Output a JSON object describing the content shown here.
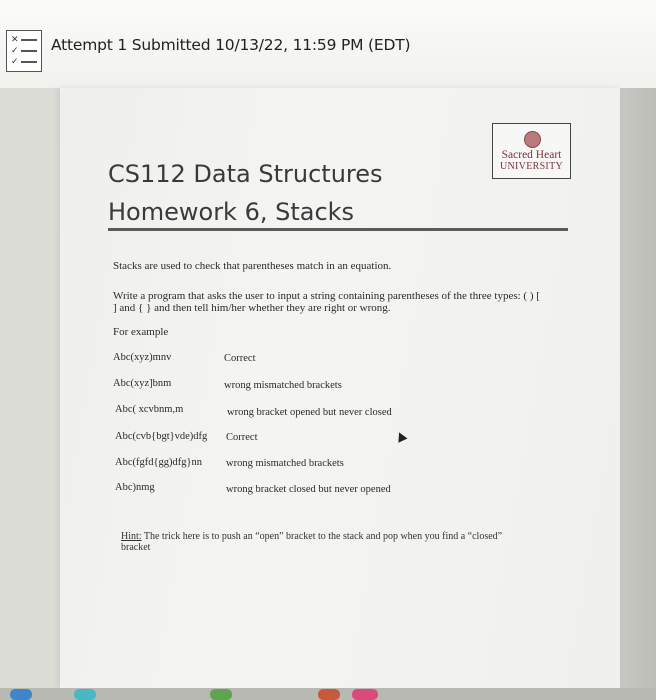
{
  "header": {
    "attempt_text": "Attempt 1 Submitted 10/13/22, 11:59 PM (EDT)",
    "icon": "checklist-icon"
  },
  "document": {
    "logo": {
      "line1": "Sacred Heart",
      "line2": "UNIVERSITY"
    },
    "course": "CS112 Data Structures",
    "homework": "Homework 6, Stacks",
    "intro": "Stacks are used to check that parentheses match in an equation.",
    "prompt_line1": "Write a program that asks the user to input a string containing parentheses of the three types:  ( )  [",
    "prompt_line2": "] and {  } and then tell him/her whether they are right or wrong.",
    "for_example": "For example",
    "examples": [
      {
        "input": "Abc(xyz)mnv",
        "result": "Correct"
      },
      {
        "input": "Abc(xyz]bnm",
        "result": "wrong mismatched brackets"
      },
      {
        "input": "Abc( xcvbnm,m",
        "result": "wrong bracket opened but never closed"
      },
      {
        "input": "Abc(cvb{bgt}vde)dfg",
        "result": "Correct"
      },
      {
        "input": "Abc(fgfd{gg)dfg}nn",
        "result": "wrong mismatched brackets"
      },
      {
        "input": "Abc)nmg",
        "result": "wrong bracket closed but never opened"
      }
    ],
    "hint_label": "Hint:",
    "hint_text1": " The trick here is to  push an “open” bracket to the stack and pop when you find a “closed”",
    "hint_text2": "bracket"
  },
  "colors": {
    "logo_red": "#7a3338",
    "text_dark": "#2a2a2a"
  }
}
